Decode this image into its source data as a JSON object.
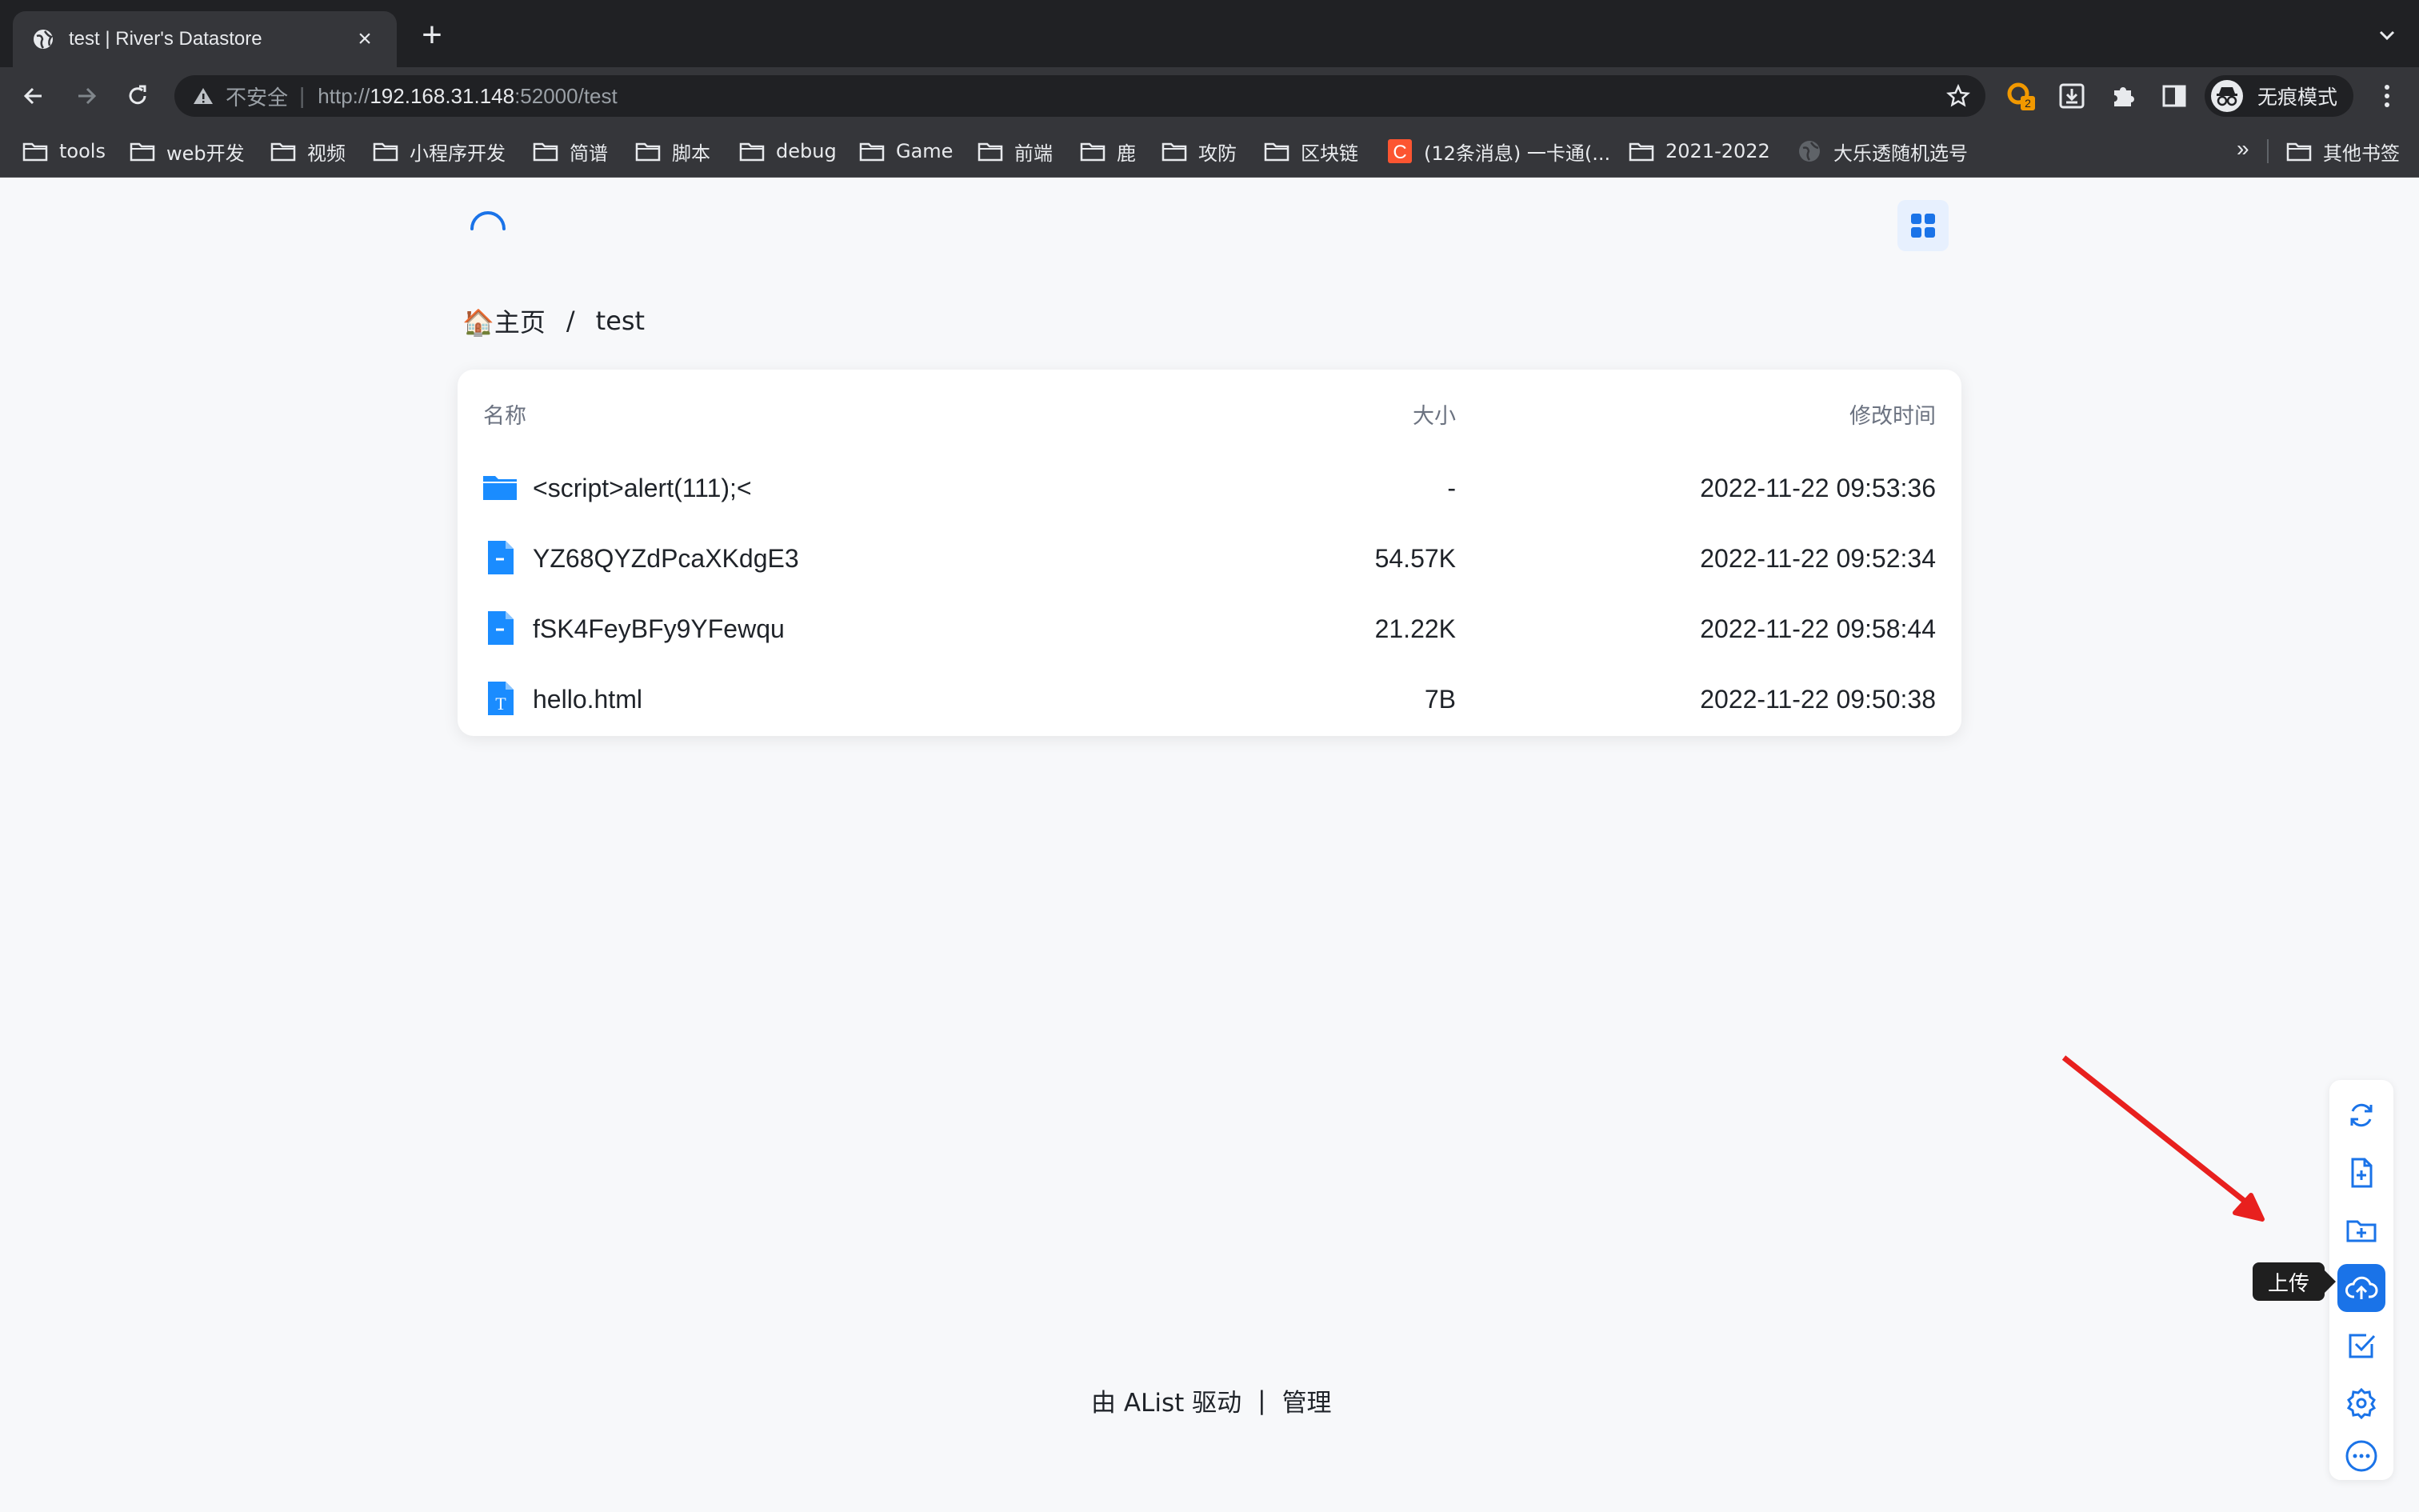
{
  "browser": {
    "tab_title": "test | River's Datastore",
    "tab_close": "×",
    "new_tab": "+",
    "insecure_label": "不安全",
    "address_separator": "|",
    "url_scheme": "http://",
    "url_host": "192.168.31.148",
    "url_rest": ":52000/test",
    "extension_badge": "2",
    "incognito_label": "无痕模式",
    "bookmarks": [
      {
        "label": "tools",
        "icon": "folder-icon"
      },
      {
        "label": "web开发",
        "icon": "folder-icon"
      },
      {
        "label": "视频",
        "icon": "folder-icon"
      },
      {
        "label": "小程序开发",
        "icon": "folder-icon"
      },
      {
        "label": "简谱",
        "icon": "folder-icon"
      },
      {
        "label": "脚本",
        "icon": "folder-icon"
      },
      {
        "label": "debug",
        "icon": "folder-icon"
      },
      {
        "label": "Game",
        "icon": "folder-icon"
      },
      {
        "label": "前端",
        "icon": "folder-icon"
      },
      {
        "label": "鹿",
        "icon": "folder-icon"
      },
      {
        "label": "攻防",
        "icon": "folder-icon"
      },
      {
        "label": "区块链",
        "icon": "folder-icon"
      },
      {
        "label": "(12条消息) 一卡通(...",
        "icon": "csdn-icon"
      },
      {
        "label": "2021-2022",
        "icon": "folder-icon"
      },
      {
        "label": "大乐透随机选号",
        "icon": "globe-icon"
      }
    ],
    "bookmarks_overflow": "»",
    "other_bookmarks": "其他书签"
  },
  "page": {
    "breadcrumb": {
      "home": "🏠主页",
      "separator": "/",
      "current": "test"
    },
    "table": {
      "columns": {
        "name": "名称",
        "size": "大小",
        "modified": "修改时间"
      },
      "rows": [
        {
          "name": "<script>alert(111);<",
          "size": "-",
          "modified": "2022-11-22 09:53:36",
          "type": "folder"
        },
        {
          "name": "YZ68QYZdPcaXKdgE3",
          "size": "54.57K",
          "modified": "2022-11-22 09:52:34",
          "type": "file"
        },
        {
          "name": "fSK4FeyBFy9YFewqu",
          "size": "21.22K",
          "modified": "2022-11-22 09:58:44",
          "type": "file"
        },
        {
          "name": "hello.html",
          "size": "7B",
          "modified": "2022-11-22 09:50:38",
          "type": "text"
        }
      ]
    },
    "footer": {
      "powered_by": "由 AList 驱动",
      "separator": "|",
      "admin": "管理"
    }
  },
  "floating_toolbar": {
    "buttons": [
      "refresh-icon",
      "new-file-icon",
      "new-folder-icon",
      "upload-icon",
      "select-icon",
      "settings-icon",
      "more-icon"
    ],
    "active_button": "upload-icon",
    "tooltip": "上传"
  },
  "colors": {
    "accent": "#1a73e8",
    "file_blue": "#1a8cff",
    "annotation": "#e8201e"
  }
}
